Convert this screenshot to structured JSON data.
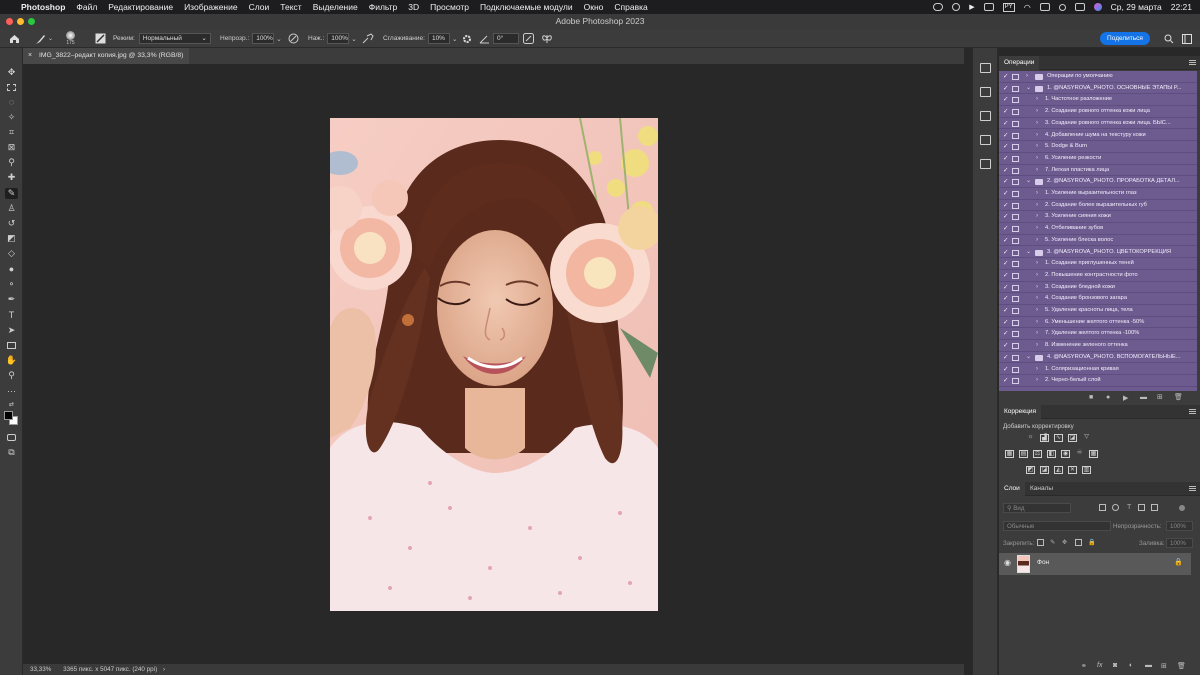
{
  "menubar": {
    "app": "Photoshop",
    "items": [
      "Файл",
      "Редактирование",
      "Изображение",
      "Слои",
      "Текст",
      "Выделение",
      "Фильтр",
      "3D",
      "Просмотр",
      "Подключаемые модули",
      "Окно",
      "Справка"
    ],
    "date": "Ср, 29 марта",
    "time": "22:21"
  },
  "window": {
    "title": "Adobe Photoshop 2023"
  },
  "options": {
    "brush_size": "175",
    "mode_label": "Режим:",
    "mode_value": "Нормальный",
    "opacity_label": "Непрозр.:",
    "opacity_value": "100%",
    "pressure_label": "Наж.:",
    "pressure_value": "100%",
    "smoothing_label": "Сглаживание:",
    "smoothing_value": "10%",
    "angle_value": "0°",
    "share_label": "Поделиться"
  },
  "document": {
    "tab_title": "IMG_3822–редакт копия.jpg @ 33,3% (RGB/8)",
    "zoom": "33,33%",
    "info": "3365 пикс. x 5047 пикс. (240 ppi)"
  },
  "actions_panel": {
    "tab": "Операции",
    "rows": [
      {
        "level": 0,
        "kind": "set",
        "label": "Операции по умолчанию",
        "open": false
      },
      {
        "level": 0,
        "kind": "set",
        "label": "1. @NASYROVA_PHOTO. ОСНОВНЫЕ ЭТАПЫ Р...",
        "open": true
      },
      {
        "level": 1,
        "kind": "action",
        "label": "1. Частотное разложение"
      },
      {
        "level": 1,
        "kind": "action",
        "label": "2. Создание ровного оттенка кожи лица"
      },
      {
        "level": 1,
        "kind": "action",
        "label": "3. Создание ровного оттенка кожи лица. БЫС..."
      },
      {
        "level": 1,
        "kind": "action",
        "label": "4. Добавление шума на текстуру кожи"
      },
      {
        "level": 1,
        "kind": "action",
        "label": "5. Dodge & Burn"
      },
      {
        "level": 1,
        "kind": "action",
        "label": "6. Усиление резкости"
      },
      {
        "level": 1,
        "kind": "action",
        "label": "7. Легкая пластика лица"
      },
      {
        "level": 0,
        "kind": "set",
        "label": "2. @NASYROVA_PHOTO. ПРОРАБОТКА ДЕТАЛ...",
        "open": true
      },
      {
        "level": 1,
        "kind": "action",
        "label": "1. Усиление выразительности глаз"
      },
      {
        "level": 1,
        "kind": "action",
        "label": "2. Создание более выразительных губ"
      },
      {
        "level": 1,
        "kind": "action",
        "label": "3. Усиление сияния кожи"
      },
      {
        "level": 1,
        "kind": "action",
        "label": "4. Отбеливание зубов"
      },
      {
        "level": 1,
        "kind": "action",
        "label": "5. Усиление блеска волос"
      },
      {
        "level": 0,
        "kind": "set",
        "label": "3. @NASYROVA_PHOTO. ЦВЕТОКОРРЕКЦИЯ",
        "open": true
      },
      {
        "level": 1,
        "kind": "action",
        "label": "1. Создание приглушенных теней"
      },
      {
        "level": 1,
        "kind": "action",
        "label": "2. Повышение контрастности фото"
      },
      {
        "level": 1,
        "kind": "action",
        "label": "3. Создание бледной кожи"
      },
      {
        "level": 1,
        "kind": "action",
        "label": "4. Создание бронзового загара"
      },
      {
        "level": 1,
        "kind": "action",
        "label": "5. Удаление красноты лица, тела"
      },
      {
        "level": 1,
        "kind": "action",
        "label": "6. Уменьшение желтого оттенка -50%"
      },
      {
        "level": 1,
        "kind": "action",
        "label": "7. Удаление желтого оттенка -100%"
      },
      {
        "level": 1,
        "kind": "action",
        "label": "8. Изменение зеленого оттенка"
      },
      {
        "level": 0,
        "kind": "set",
        "label": "4. @NASYROVA_PHOTO. ВСПОМОГАТЕЛЬНЫЕ...",
        "open": true
      },
      {
        "level": 1,
        "kind": "action",
        "label": "1. Соляризационная кривая"
      },
      {
        "level": 1,
        "kind": "action",
        "label": "2. Черно-белый слой"
      }
    ]
  },
  "adjustments_panel": {
    "tab": "Коррекция",
    "subtitle": "Добавить корректировку"
  },
  "layers_panel": {
    "tab_layers": "Слои",
    "tab_channels": "Каналы",
    "search_placeholder": "Вид",
    "blend_mode": "Обычные",
    "opacity_label": "Непрозрачность:",
    "opacity_value": "100%",
    "lock_label": "Закрепить:",
    "fill_label": "Заливка:",
    "fill_value": "100%",
    "layers": [
      {
        "name": "Фон",
        "visible": true,
        "locked": true
      }
    ]
  },
  "colors": {
    "actions_bg": "#6d5b90",
    "share_button": "#1473e6",
    "photo_background": "#f3c6bd"
  }
}
